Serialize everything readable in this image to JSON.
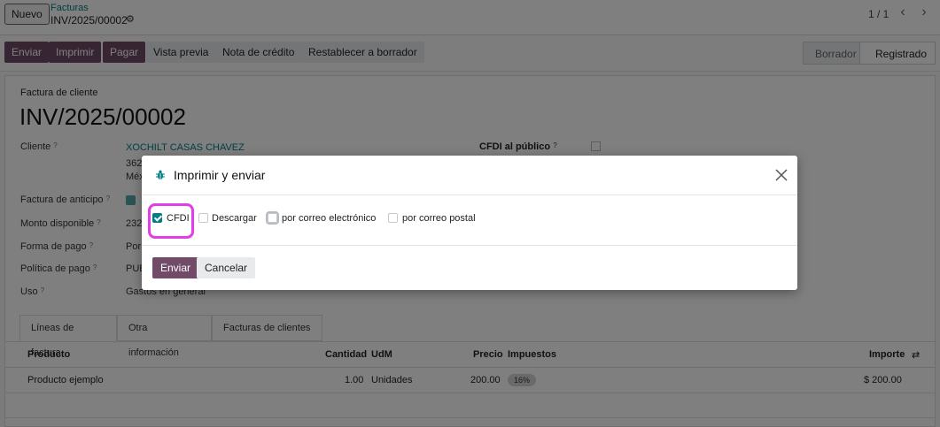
{
  "topbar": {
    "new_button": "Nuevo",
    "breadcrumb_parent": "Facturas",
    "breadcrumb_current": "INV/2025/00002",
    "pager": "1 / 1"
  },
  "actions": {
    "send": "Enviar",
    "print": "Imprimir",
    "pay": "Pagar",
    "preview": "Vista previa",
    "credit_note": "Nota de crédito",
    "reset_draft": "Restablecer a borrador"
  },
  "statusbar": {
    "draft": "Borrador",
    "posted": "Registrado"
  },
  "invoice": {
    "doc_type": "Factura de cliente",
    "number": "INV/2025/00002",
    "customer_label": "Cliente",
    "customer_name": "XOCHILT CASAS CHAVEZ",
    "customer_line2": "362",
    "customer_line3": "Méx",
    "cfdi_public_label": "CFDI al público",
    "advance_label": "Factura de anticipo",
    "available_label": "Monto disponible",
    "available_value": "232",
    "payment_form_label": "Forma de pago",
    "payment_form_value": "Por",
    "payment_policy_label": "Política de pago",
    "payment_policy_value": "PUE",
    "use_label": "Uso",
    "use_value": "Gastos en general"
  },
  "tabs": [
    "Líneas de factura",
    "Otra información",
    "Facturas de clientes"
  ],
  "table": {
    "headers": {
      "product": "Producto",
      "quantity": "Cantidad",
      "uom": "UdM",
      "price": "Precio",
      "taxes": "Impuestos",
      "amount": "Importe"
    },
    "rows": [
      {
        "product": "Producto ejemplo",
        "quantity": "1.00",
        "uom": "Unidades",
        "price": "200.00",
        "tax": "16%",
        "amount": "$ 200.00"
      }
    ]
  },
  "dialog": {
    "title": "Imprimir y enviar",
    "options": [
      {
        "label": "CFDI",
        "checked": true
      },
      {
        "label": "Descargar",
        "checked": false
      },
      {
        "label": "por correo electrónico",
        "checked": false
      },
      {
        "label": "por correo postal",
        "checked": false
      }
    ],
    "send_button": "Enviar",
    "cancel_button": "Cancelar"
  },
  "colors": {
    "primary": "#714b67",
    "link": "#017e84",
    "highlight": "#e23de6"
  }
}
